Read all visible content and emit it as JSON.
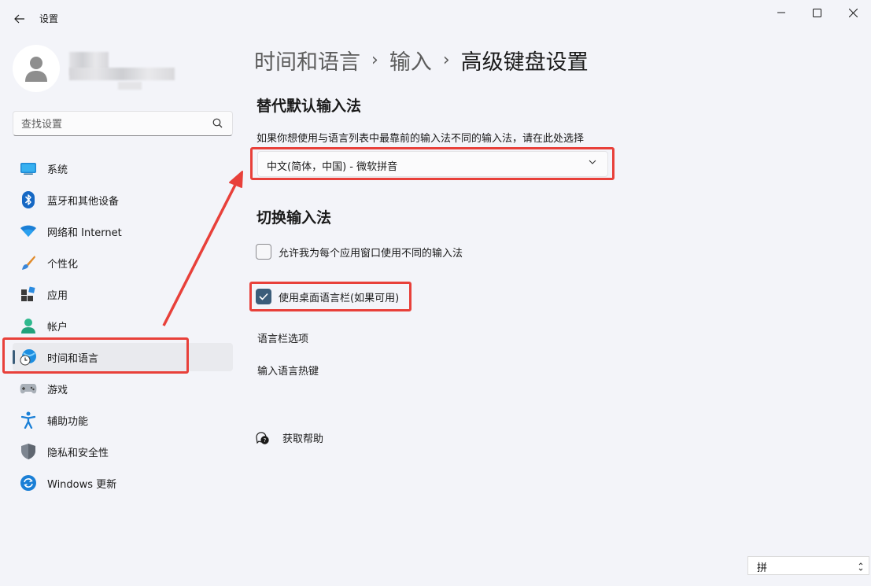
{
  "window": {
    "title": "设置",
    "controls": [
      "minimize",
      "maximize",
      "close"
    ]
  },
  "search": {
    "placeholder": "查找设置",
    "value": ""
  },
  "sidebar": {
    "items": [
      {
        "label": "系统",
        "icon": "monitor-icon"
      },
      {
        "label": "蓝牙和其他设备",
        "icon": "bluetooth-icon"
      },
      {
        "label": "网络和 Internet",
        "icon": "wifi-icon"
      },
      {
        "label": "个性化",
        "icon": "brush-icon"
      },
      {
        "label": "应用",
        "icon": "apps-icon"
      },
      {
        "label": "帐户",
        "icon": "account-icon"
      },
      {
        "label": "时间和语言",
        "icon": "globe-clock-icon",
        "selected": true
      },
      {
        "label": "游戏",
        "icon": "gamepad-icon"
      },
      {
        "label": "辅助功能",
        "icon": "accessibility-icon"
      },
      {
        "label": "隐私和安全性",
        "icon": "shield-icon"
      },
      {
        "label": "Windows 更新",
        "icon": "update-icon"
      }
    ]
  },
  "breadcrumb": {
    "parts": [
      "时间和语言",
      "输入"
    ],
    "current": "高级键盘设置",
    "separator": "›"
  },
  "override_section": {
    "heading": "替代默认输入法",
    "description": "如果你想使用与语言列表中最靠前的输入法不同的输入法，请在此处选择",
    "dropdown_value": "中文(简体，中国) - 微软拼音"
  },
  "switch_section": {
    "heading": "切换输入法",
    "checkbox1": {
      "label": "允许我为每个应用窗口使用不同的输入法",
      "checked": false
    },
    "checkbox2": {
      "label": "使用桌面语言栏(如果可用)",
      "checked": true
    },
    "link1": "语言栏选项",
    "link2": "输入语言热键"
  },
  "help": {
    "label": "获取帮助"
  },
  "ime_indicator": {
    "char": "拼"
  },
  "colors": {
    "accent": "#3b5d7a",
    "highlight": "#e8403a",
    "background": "#f3f4f9"
  }
}
